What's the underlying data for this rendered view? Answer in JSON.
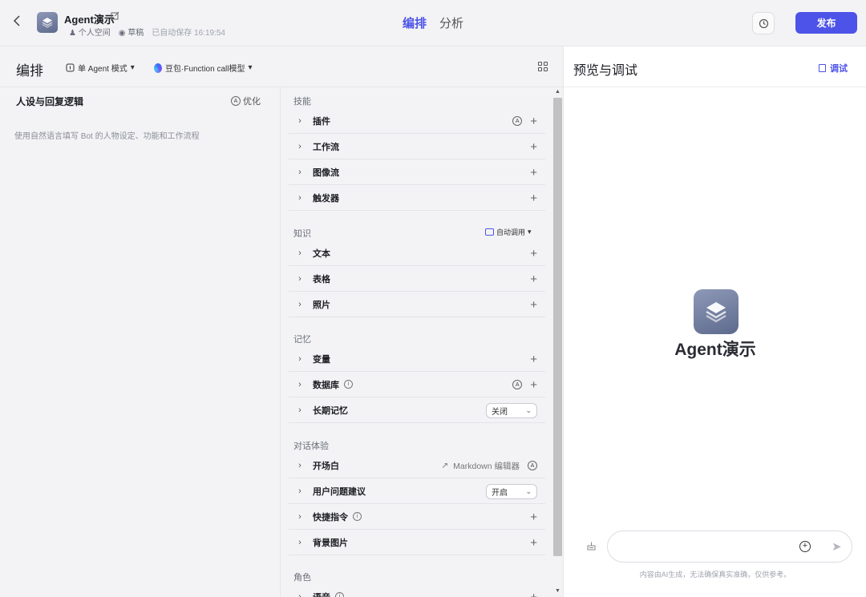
{
  "topbar": {
    "bot_name": "Agent演示",
    "space": "个人空间",
    "status": "草稿",
    "saved": "已自动保存 16:19:54",
    "tabs": [
      {
        "label": "编排",
        "active": true
      },
      {
        "label": "分析",
        "active": false
      }
    ],
    "publish_label": "发布",
    "accent_color": "#4d53e8"
  },
  "editor": {
    "title": "编排",
    "mode": "单 Agent 模式",
    "model": "豆包·Function call模型"
  },
  "persona": {
    "title": "人设与回复逻辑",
    "optimize_label": "优化",
    "placeholder": "使用自然语言填写 Bot 的人物设定、功能和工作流程"
  },
  "skills": {
    "sections": [
      {
        "label": "技能",
        "items": [
          "插件",
          "工作流",
          "图像流",
          "触发器"
        ]
      },
      {
        "label": "知识",
        "auto_call": "自动调用",
        "items": [
          "文本",
          "表格",
          "照片"
        ]
      },
      {
        "label": "记忆",
        "items": [
          "变量",
          "数据库",
          "长期记忆"
        ],
        "long_memory_value": "关闭"
      },
      {
        "label": "对话体验",
        "items": [
          "开场白",
          "用户问题建议",
          "快捷指令",
          "背景图片"
        ],
        "md_editor": "Markdown 编辑器",
        "suggest_value": "开启"
      },
      {
        "label": "角色",
        "items": [
          "语音"
        ]
      }
    ]
  },
  "preview": {
    "title": "预览与调试",
    "debug_label": "调试",
    "bot_name": "Agent演示",
    "disclaimer": "内容由AI生成，无法确保真实准确，仅供参考。"
  },
  "icons": {
    "back": "chevron-left-icon",
    "edit": "edit-icon",
    "history": "history-icon",
    "grid": "grid-icon",
    "send": "send-icon"
  }
}
